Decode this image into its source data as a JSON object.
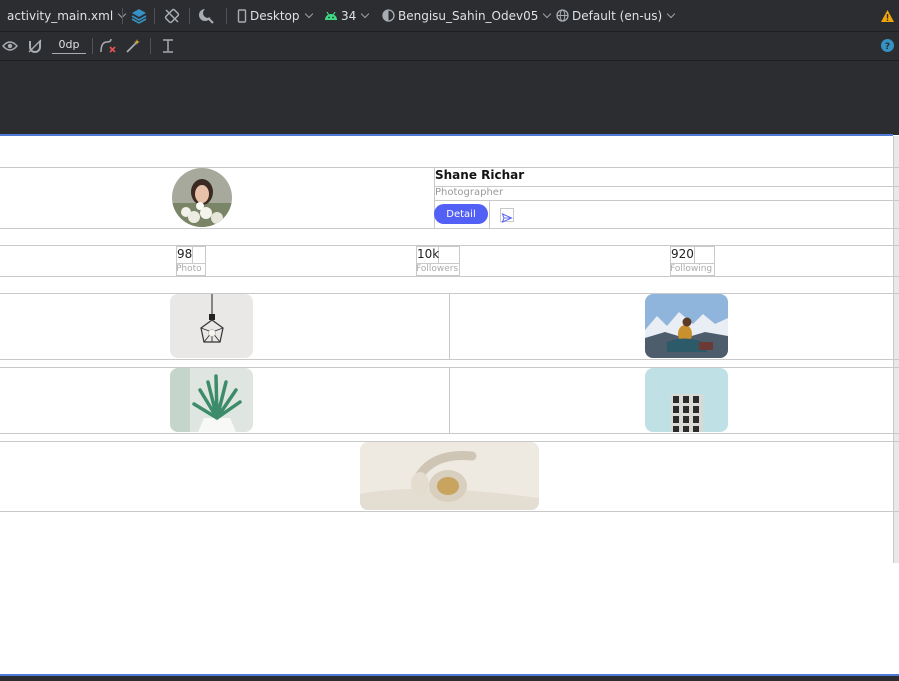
{
  "toolbar": {
    "file": "activity_main.xml",
    "device": "Desktop",
    "api_level": "34",
    "theme": "Bengisu_Sahin_Odev05",
    "locale": "Default (en-us)",
    "margin_value": "0dp"
  },
  "profile": {
    "name": "Shane Richar",
    "role": "Photographer",
    "detail_button": "Detail"
  },
  "stats": [
    {
      "value": "98",
      "label": "Photo"
    },
    {
      "value": "10k",
      "label": "Followers"
    },
    {
      "value": "920",
      "label": "Following"
    }
  ],
  "colors": {
    "accent": "#5260f5",
    "ide_bg": "#2b2d30",
    "selection_blue": "#4f7bd8",
    "warning": "#f0a30a"
  }
}
